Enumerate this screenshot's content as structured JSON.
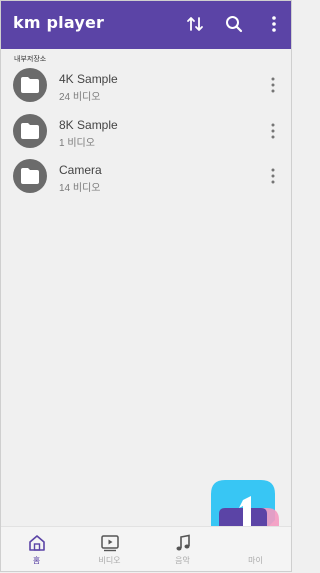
{
  "appbar": {
    "title": "km player",
    "icons": [
      "sort-icon",
      "search-icon",
      "more-vert-icon"
    ],
    "color": "#5b44a6"
  },
  "section": {
    "label": "내부저장소"
  },
  "folders": [
    {
      "name": "4K Sample",
      "count": "24 비디오",
      "icon": "folder-icon"
    },
    {
      "name": "8K Sample",
      "count": "1 비디오",
      "icon": "folder-icon"
    },
    {
      "name": "Camera",
      "count": "14 비디오",
      "icon": "folder-icon"
    }
  ],
  "bottom_nav": [
    {
      "label": "홈",
      "icon": "home-icon",
      "active": true
    },
    {
      "label": "비디오",
      "icon": "video-icon",
      "active": false
    },
    {
      "label": "음악",
      "icon": "music-note-icon",
      "active": false
    },
    {
      "label": "마이",
      "icon": "my-icon",
      "active": false
    }
  ],
  "colors": {
    "accent": "#5b44a6",
    "background": "#f0f0f0",
    "folder_avatar": "#6b6b6b",
    "logo_blue": "#38c6f4",
    "logo_pink": "#f49ac1"
  }
}
